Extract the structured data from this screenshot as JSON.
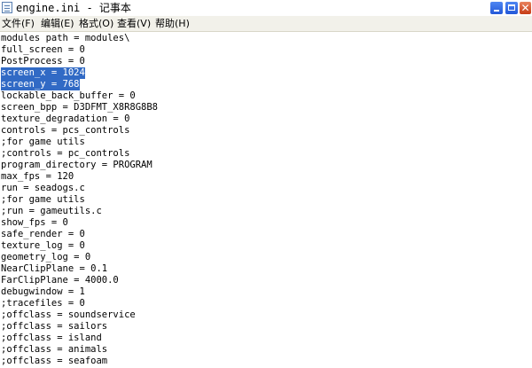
{
  "window": {
    "title": "engine.ini - 记事本"
  },
  "menu": [
    {
      "label": "文件(F)"
    },
    {
      "label": "编辑(E)"
    },
    {
      "label": "格式(O)"
    },
    {
      "label": "查看(V)"
    },
    {
      "label": "帮助(H)"
    }
  ],
  "editor": {
    "lines": [
      "modules path = modules\\",
      "full_screen = 0",
      "PostProcess = 0",
      "screen_x = 1024",
      "screen_y = 768",
      "lockable_back_buffer = 0",
      "screen_bpp = D3DFMT_X8R8G8B8",
      "texture_degradation = 0",
      "controls = pcs_controls",
      ";for game utils",
      ";controls = pc_controls",
      "program_directory = PROGRAM",
      "max_fps = 120",
      "run = seadogs.c",
      ";for game utils",
      ";run = gameutils.c",
      "show_fps = 0",
      "safe_render = 0",
      "texture_log = 0",
      "geometry_log = 0",
      "NearClipPlane = 0.1",
      "FarClipPlane = 4000.0",
      "debugwindow = 1",
      ";tracefiles = 0",
      ";offclass = soundservice",
      ";offclass = sailors",
      ";offclass = island",
      ";offclass = animals",
      ";offclass = seafoam"
    ],
    "selected_lines": [
      3,
      4
    ]
  },
  "colors": {
    "selection": "#316ac5",
    "titlebar_button_blue": "#2358d8",
    "close_button": "#c63b15",
    "menubar_bg": "#f2f1ea"
  }
}
